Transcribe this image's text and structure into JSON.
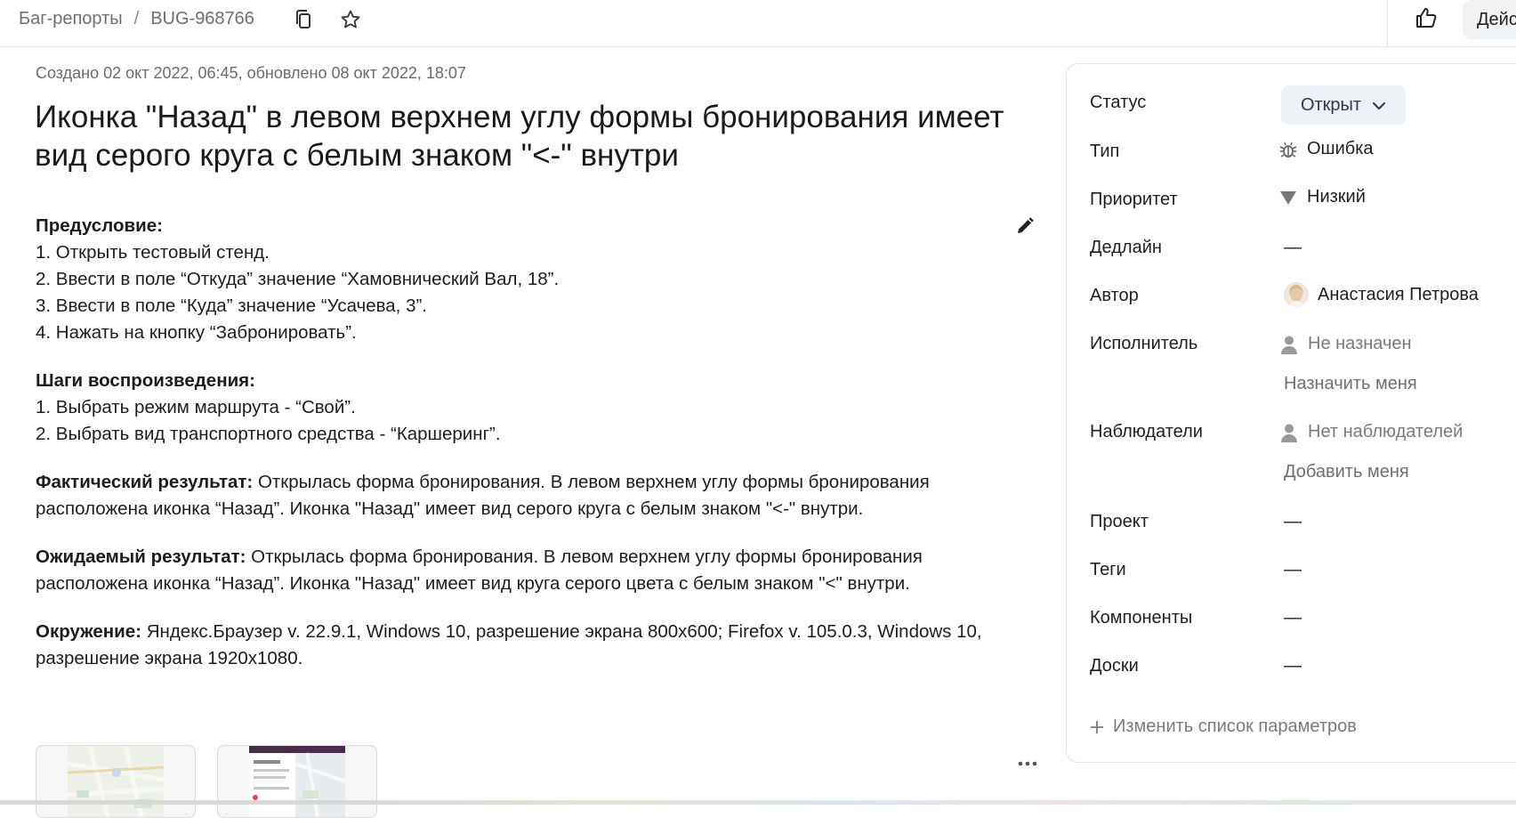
{
  "header": {
    "breadcrumb_root": "Баг-репорты",
    "breadcrumb_sep": "/",
    "issue_key": "BUG-968766",
    "action_label": "Дейс"
  },
  "issue": {
    "meta": "Создано 02 окт 2022, 06:45, обновлено 08 окт 2022, 18:07",
    "title": "Иконка \"Назад\" в левом верхнем углу формы бронирования имеет вид серого круга с белым знаком \"<-\" внутри",
    "precondition": {
      "heading": "Предусловие:",
      "items": [
        "1. Открыть тестовый стенд.",
        "2. Ввести в поле “Откуда” значение “Хамовнический Вал, 18”.",
        "3. Ввести в поле “Куда” значение “Усачева, 3”.",
        "4. Нажать на кнопку “Забронировать”."
      ]
    },
    "steps": {
      "heading": "Шаги воспроизведения:",
      "items": [
        "1. Выбрать режим маршрута - “Свой”.",
        "2. Выбрать вид транспортного средства - “Каршеринг”."
      ]
    },
    "actual": {
      "heading": "Фактический результат:",
      "text": "Открылась форма бронирования. В левом верхнем углу формы бронирования расположена иконка “Назад”. Иконка \"Назад\" имеет вид серого круга с белым знаком \"<-\" внутри."
    },
    "expected": {
      "heading": "Ожидаемый результат:",
      "text": "Открылась форма бронирования. В левом верхнем углу формы бронирования расположена иконка “Назад”. Иконка \"Назад\" имеет вид круга серого цвета с белым знаком \"<\" внутри."
    },
    "environment": {
      "heading": "Окружение:",
      "text": "Яндекс.Браузер v. 22.9.1, Windows 10, разрешение экрана 800х600; Firefox v. 105.0.3, Windows 10, разрешение экрана 1920х1080."
    }
  },
  "sidebar": {
    "status_label": "Статус",
    "status_value": "Открыт",
    "type_label": "Тип",
    "type_value": "Ошибка",
    "priority_label": "Приоритет",
    "priority_value": "Низкий",
    "deadline_label": "Дедлайн",
    "deadline_value": "—",
    "author_label": "Автор",
    "author_value": "Анастасия Петрова",
    "assignee_label": "Исполнитель",
    "assignee_value": "Не назначен",
    "assign_me": "Назначить меня",
    "watchers_label": "Наблюдатели",
    "watchers_value": "Нет наблюдателей",
    "add_me": "Добавить меня",
    "project_label": "Проект",
    "project_value": "—",
    "tags_label": "Теги",
    "tags_value": "—",
    "components_label": "Компоненты",
    "components_value": "—",
    "boards_label": "Доски",
    "boards_value": "—",
    "change_params": "Изменить список параметров"
  },
  "icons": {
    "copy": "copy-icon",
    "favorite": "star-icon",
    "like": "thumbs-up-icon",
    "edit": "pencil-icon",
    "type": "bug-icon",
    "priority": "triangle-down-icon",
    "user": "user-icon",
    "more": "more-dots-icon"
  },
  "colors": {
    "status_bg": "#eef1f6",
    "muted_text": "#7a7a7a"
  }
}
